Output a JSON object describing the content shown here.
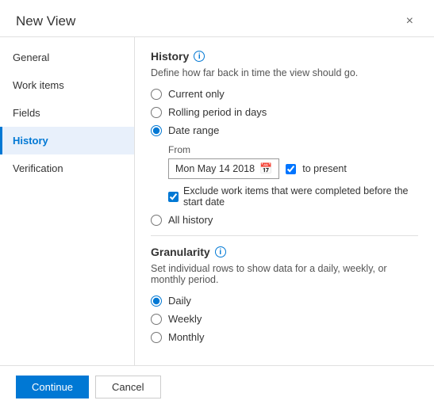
{
  "dialog": {
    "title": "New View",
    "close_label": "×"
  },
  "sidebar": {
    "items": [
      {
        "id": "general",
        "label": "General",
        "active": false
      },
      {
        "id": "work-items",
        "label": "Work items",
        "active": false
      },
      {
        "id": "fields",
        "label": "Fields",
        "active": false
      },
      {
        "id": "history",
        "label": "History",
        "active": true
      },
      {
        "id": "verification",
        "label": "Verification",
        "active": false
      }
    ]
  },
  "content": {
    "history_section": {
      "title": "History",
      "info_icon": "i",
      "description": "Define how far back in time the view should go.",
      "radio_options": [
        {
          "id": "current-only",
          "label": "Current only",
          "checked": false
        },
        {
          "id": "rolling-period",
          "label": "Rolling period in days",
          "checked": false
        },
        {
          "id": "date-range",
          "label": "Date range",
          "checked": true
        },
        {
          "id": "all-history",
          "label": "All history",
          "checked": false
        }
      ],
      "date_range": {
        "from_label": "From",
        "date_value": "Mon May 14 2018",
        "to_present_label": "to present",
        "to_present_checked": true,
        "exclude_label": "Exclude work items that were completed before the start date",
        "exclude_checked": true
      }
    },
    "granularity_section": {
      "title": "Granularity",
      "info_icon": "i",
      "description": "Set individual rows to show data for a daily, weekly, or monthly period.",
      "radio_options": [
        {
          "id": "daily",
          "label": "Daily",
          "checked": true
        },
        {
          "id": "weekly",
          "label": "Weekly",
          "checked": false
        },
        {
          "id": "monthly",
          "label": "Monthly",
          "checked": false
        }
      ]
    }
  },
  "footer": {
    "continue_label": "Continue",
    "cancel_label": "Cancel"
  }
}
